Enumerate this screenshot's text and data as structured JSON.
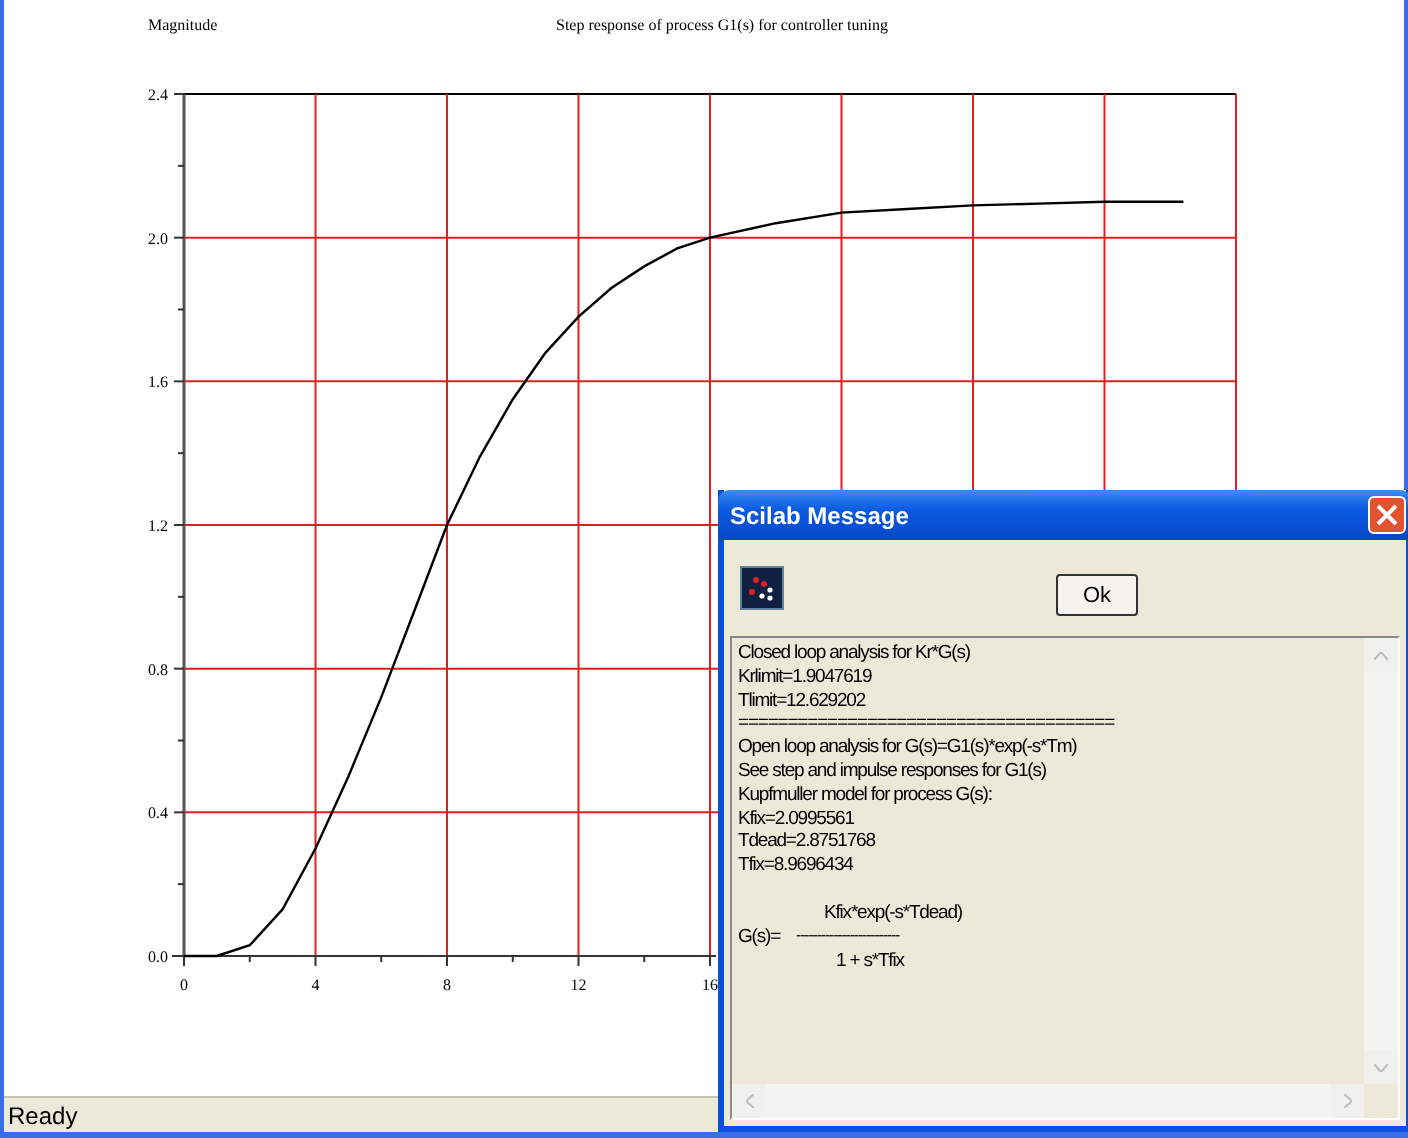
{
  "plot": {
    "chart_data": {
      "type": "line",
      "title": "Step response of process  G1(s) for controller tuning",
      "ylabel": "Magnitude",
      "x": [
        0,
        1,
        2,
        3,
        4,
        5,
        6,
        7,
        8,
        9,
        10,
        11,
        12,
        13,
        14,
        15,
        16,
        18,
        20,
        22,
        24,
        26,
        28,
        30.4
      ],
      "series": [
        {
          "color": "#000000",
          "values": [
            0,
            0,
            0.03,
            0.13,
            0.3,
            0.5,
            0.72,
            0.96,
            1.2,
            1.39,
            1.55,
            1.68,
            1.78,
            1.86,
            1.92,
            1.97,
            2.0,
            2.04,
            2.07,
            2.08,
            2.09,
            2.095,
            2.1,
            2.1
          ]
        }
      ],
      "grid": true,
      "xlim": [
        0,
        32
      ],
      "ylim": [
        0,
        2.4
      ],
      "xticks": [
        0,
        4,
        8,
        12,
        16
      ],
      "yticks": [
        {
          "value": 0,
          "label": "0.0"
        },
        {
          "value": 0.4,
          "label": "0.4"
        },
        {
          "value": 0.8,
          "label": "0.8"
        },
        {
          "value": 1.2,
          "label": "1.2"
        },
        {
          "value": 1.6,
          "label": "1.6"
        },
        {
          "value": 2.0,
          "label": "2.0"
        },
        {
          "value": 2.4,
          "label": "2.4"
        }
      ]
    }
  },
  "dialog": {
    "title": "Scilab Message",
    "ok_button": "Ok",
    "message_lines": [
      "Closed loop analysis for Kr*G(s)",
      "Krlimit=1.9047619",
      "Tlimit=12.629202",
      "======================================",
      "Open loop analysis for G(s)=G1(s)*exp(-s*Tm)",
      "See step and impulse responses for G1(s)",
      "Kupfmuller model for process G(s):",
      "Kfix=2.0995561",
      "Tdead=2.8751768",
      "Tfix=8.9696434"
    ],
    "formula": {
      "lhs": "G(s)=",
      "numerator": "Kfix*exp(-s*Tdead)",
      "bar": "-------------------------",
      "denominator": "1 + s*Tfix"
    }
  },
  "status_bar": {
    "text": "Ready"
  }
}
